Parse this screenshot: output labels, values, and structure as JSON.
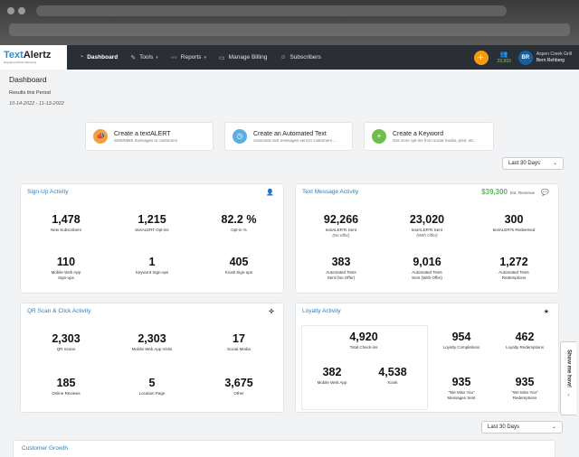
{
  "nav": {
    "logo_text_1": "Text",
    "logo_text_2": "Alertz",
    "logo_tagline": "Engaging Mobile Marketing",
    "items": [
      {
        "label": "Dashboard",
        "icon": "dashboard-icon"
      },
      {
        "label": "Tools",
        "icon": "wrench-icon"
      },
      {
        "label": "Reports",
        "icon": "chart-icon"
      },
      {
        "label": "Manage Billing",
        "icon": "card-icon"
      },
      {
        "label": "Subscribers",
        "icon": "people-icon"
      }
    ],
    "subscriber_count": "23,593",
    "avatar_initials": "BR",
    "account_business": "Aspen Creek Grill",
    "account_user": "Bern Rehberg"
  },
  "page": {
    "title": "Dashboard",
    "results_label": "Results this Period",
    "results_range": "10-14-2022 - 11-13-2022"
  },
  "create_buttons": [
    {
      "title": "Create a textALERT",
      "subtitle": "SMS/MMS messages to customers",
      "color": "#f0a03a",
      "icon": "megaphone-icon"
    },
    {
      "title": "Create an Automated Text",
      "subtitle": "Automatic text messages sent to customers ...",
      "color": "#5aaee0",
      "icon": "clock-icon"
    },
    {
      "title": "Create a Keyword",
      "subtitle": "Get more opt-ins from social media, print, etc.",
      "color": "#6cc04a",
      "icon": "plus-icon"
    }
  ],
  "period_select_top": "Last 30 Days",
  "period_select_bottom": "Last 30 Days",
  "signup": {
    "title": "Sign-Up Activity",
    "metrics": [
      {
        "value": "1,478",
        "label": "New Subscribers"
      },
      {
        "value": "1,215",
        "label": "textALERT Opt-ins"
      },
      {
        "value": "82.2 %",
        "label": "Opt-in %"
      },
      {
        "value": "110",
        "label": "Mobile Web App",
        "label2": "Sign-ups"
      },
      {
        "value": "1",
        "label": "Keyword Sign-ups"
      },
      {
        "value": "405",
        "label": "Kiosk Sign-ups"
      }
    ]
  },
  "text_message": {
    "title": "Text Message Activity",
    "revenue": "$39,300",
    "revenue_label": "Est. Revenue",
    "metrics": [
      {
        "value": "92,266",
        "label": "textALERTs Sent",
        "sub": "(No offer)"
      },
      {
        "value": "23,020",
        "label": "textALERTs Sent",
        "sub": "(With Offer)"
      },
      {
        "value": "300",
        "label": "textALERTs Redeemed"
      },
      {
        "value": "383",
        "label": "Automated Texts",
        "label2": "Sent (No Offer)"
      },
      {
        "value": "9,016",
        "label": "Automated Texts",
        "label2": "Sent (With Offer)"
      },
      {
        "value": "1,272",
        "label": "Automated Texts",
        "label2": "Redemptions"
      }
    ]
  },
  "qr": {
    "title": "QR Scan & Click Activity",
    "metrics": [
      {
        "value": "2,303",
        "label": "QR Scans"
      },
      {
        "value": "2,303",
        "label": "Mobile Web App Visits"
      },
      {
        "value": "17",
        "label": "Social Media"
      },
      {
        "value": "185",
        "label": "Online Reviews"
      },
      {
        "value": "5",
        "label": "Location Page"
      },
      {
        "value": "3,675",
        "label": "Other"
      }
    ]
  },
  "loyalty": {
    "title": "Loyalty Activity",
    "metrics": [
      {
        "value": "4,920",
        "label": "Total Check-ins"
      },
      {
        "value": "954",
        "label": "Loyalty Completions"
      },
      {
        "value": "462",
        "label": "Loyalty Redemptions"
      },
      {
        "value": "382",
        "label": "Mobile Web App"
      },
      {
        "value": "4,538",
        "label": "Kiosk"
      },
      {
        "value": "935",
        "label": "\"We Miss You\"",
        "label2": "Messages Sent"
      },
      {
        "value": "935",
        "label": "\"We Miss You\"",
        "label2": "Redemptions"
      }
    ]
  },
  "show_me_how": "Show me how!",
  "customer_growth": {
    "title": "Customer Growth"
  }
}
